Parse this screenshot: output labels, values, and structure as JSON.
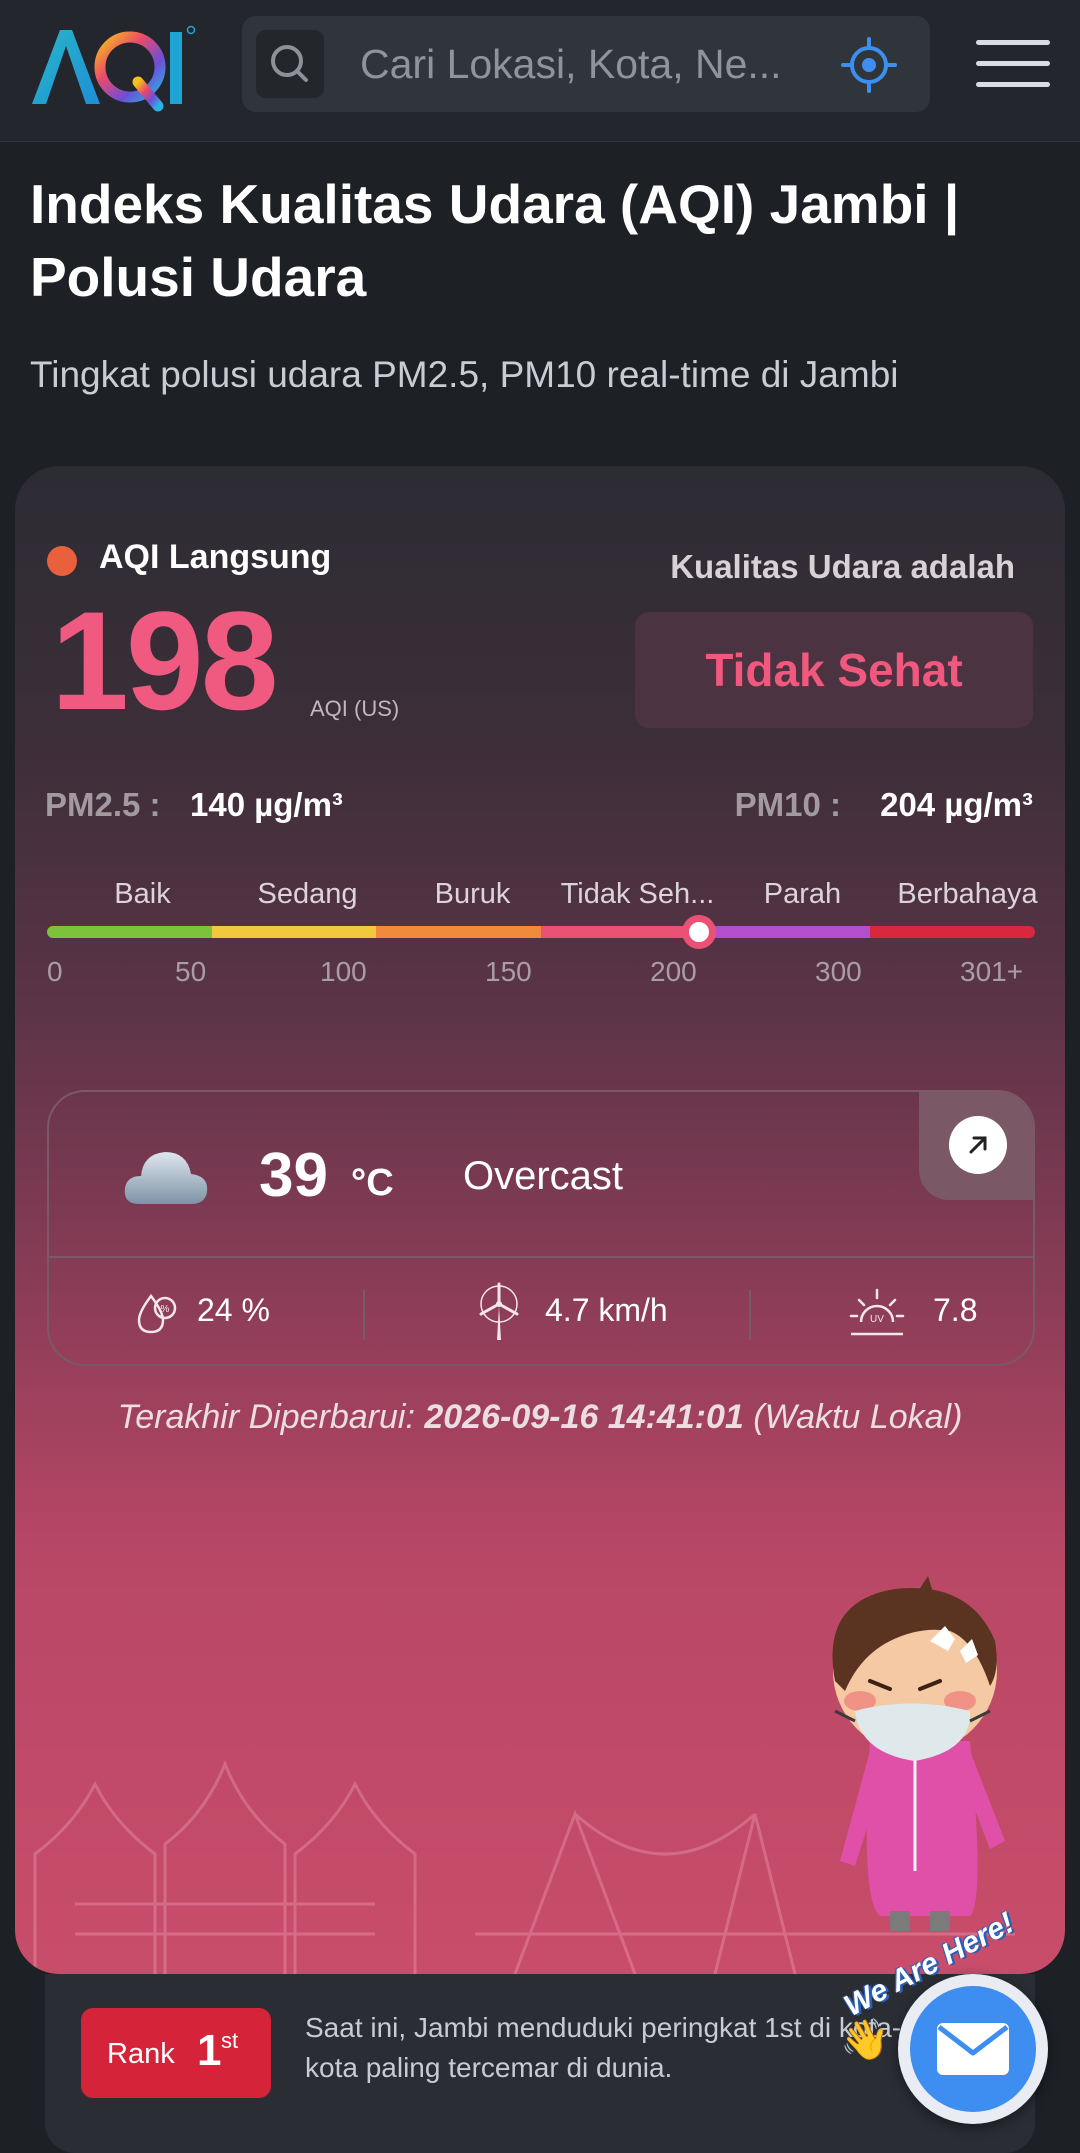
{
  "header": {
    "logo_text": "AQI",
    "search_placeholder": "Cari Lokasi, Kota, Ne..."
  },
  "page": {
    "title": "Indeks Kualitas Udara (AQI) Jambi | Polusi Udara",
    "subtitle": "Tingkat polusi udara PM2.5, PM10 real-time di Jambi"
  },
  "aqi": {
    "live_label": "AQI Langsung",
    "value": "198",
    "unit": "AQI (US)",
    "quality_caption": "Kualitas Udara adalah",
    "quality_status": "Tidak Sehat",
    "pm25_label": "PM2.5 :",
    "pm25_value": "140 µg/m³",
    "pm10_label": "PM10 :",
    "pm10_value": "204 µg/m³",
    "scale_categories": [
      "Baik",
      "Sedang",
      "Buruk",
      "Tidak Seh...",
      "Parah",
      "Berbahaya"
    ],
    "scale_numbers": [
      "0",
      "50",
      "100",
      "150",
      "200",
      "300",
      "301+"
    ],
    "scale_colors": [
      "#7cc23a",
      "#f0c93c",
      "#f08a3a",
      "#ea5275",
      "#b34fcc",
      "#d9283e"
    ],
    "marker_value": 198
  },
  "weather": {
    "temperature": "39",
    "temperature_unit": "°C",
    "condition": "Overcast",
    "humidity": "24 %",
    "wind": "4.7 km/h",
    "uv": "7.8"
  },
  "updated": {
    "prefix": "Terakhir Diperbarui:",
    "timestamp": "2026-09-16 14:41:01",
    "suffix": "(Waktu Lokal)"
  },
  "rank": {
    "label": "Rank",
    "number": "1",
    "suffix": "st",
    "text": "Saat ini, Jambi menduduki peringkat 1st di kota-kota paling tercemar di dunia."
  },
  "contact": {
    "label": "We Are Here!"
  }
}
